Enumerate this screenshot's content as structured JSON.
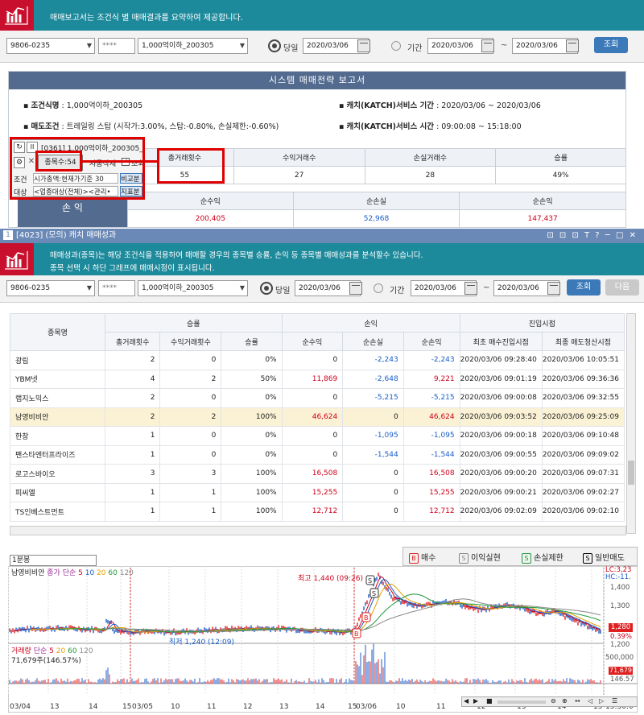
{
  "top_window": {
    "banner_text": "매매보고서는 조건식 별 매매결과를 요약하여 제공합니다.",
    "account": "9806-0235",
    "password": "****",
    "condition": "1,000억이하_200305",
    "today_label": "당일",
    "today_date": "2020/03/06",
    "period_label": "기간",
    "period_from": "2020/03/06",
    "period_to": "2020/03/06",
    "search_button": "조회",
    "report_title": "시스템 매매전략 보고서",
    "info": {
      "cond_name_label": "조건식명",
      "cond_name": ": 1,000억이하_200305",
      "sell_cond_label": "매도조건",
      "sell_cond": ": 트레일링 스탑 (시작가:3.00%, 스탑:-0.80%, 손실제한:-0.60%)",
      "catch_period_label": "캐치(KATCH)서비스 기간",
      "catch_period": ": 2020/03/06 ~ 2020/03/06",
      "catch_time_label": "캐치(KATCH)서비스 시간",
      "catch_time": ": 09:00:08 ~ 15:18:00"
    },
    "summary": {
      "headers": [
        "총거래횟수",
        "수익거래수",
        "손실거래수",
        "승률"
      ],
      "values": [
        "55",
        "27",
        "28",
        "49%"
      ],
      "pl_label": "손 익",
      "pl_headers": [
        "순수익",
        "순손실",
        "순손익"
      ],
      "pl_values": [
        "200,405",
        "52,968",
        "147,437"
      ]
    },
    "popup": {
      "title": "[0361] 1,000억이하_200305_",
      "count": "종목수:54",
      "auto_delete": "자동삭제",
      "check_label": "조회",
      "cond_label": "조건",
      "cond_value": "시가총액:현재가기준 30",
      "compare": "비교분",
      "target_label": "대상",
      "target_value": "<업종대상(전체)><관리•",
      "indicator": "지표분"
    }
  },
  "second_window": {
    "title": "[4023] (모의) 캐치 매매성과",
    "title_icons": "⊡ ⊡ ⊡ T ? ─ □ ✕",
    "banner_line1": "매매성과(종목)는 해당 조건식을 적용하여 매매할 경우의 종목별 승률, 손익 등 종목별 매매성과를 분석할수 있습니다.",
    "banner_line2": "종목 선택 시 하단 그래프에 매매시점이 표시됩니다.",
    "account": "9806-0235",
    "password": "****",
    "condition": "1,000억이하_200305",
    "today_label": "당일",
    "today_date": "2020/03/06",
    "period_label": "기간",
    "period_from": "2020/03/06",
    "period_to": "2020/03/06",
    "search_button": "조회",
    "next_button": "다음",
    "table": {
      "name_header": "종목명",
      "group_winrate": "승률",
      "group_pl": "손익",
      "group_entry": "진입시점",
      "sub_headers": [
        "총거래횟수",
        "수익거래횟수",
        "승률",
        "순수익",
        "순손실",
        "순손익",
        "최초 매수진입시점",
        "최종 매도청산시점"
      ],
      "rows": [
        [
          "광림",
          "2",
          "0",
          "0%",
          "0",
          "-2,243",
          "-2,243",
          "2020/03/06 09:28:40",
          "2020/03/06 10:05:51"
        ],
        [
          "YBM넷",
          "4",
          "2",
          "50%",
          "11,869",
          "-2,648",
          "9,221",
          "2020/03/06 09:01:19",
          "2020/03/06 09:36:36"
        ],
        [
          "랩지노믹스",
          "2",
          "0",
          "0%",
          "0",
          "-5,215",
          "-5,215",
          "2020/03/06 09:00:08",
          "2020/03/06 09:32:55"
        ],
        [
          "남영비비안",
          "2",
          "2",
          "100%",
          "46,624",
          "0",
          "46,624",
          "2020/03/06 09:03:52",
          "2020/03/06 09:25:09"
        ],
        [
          "한창",
          "1",
          "0",
          "0%",
          "0",
          "-1,095",
          "-1,095",
          "2020/03/06 09:00:18",
          "2020/03/06 09:10:48"
        ],
        [
          "팬스타엔터프라이즈",
          "1",
          "0",
          "0%",
          "0",
          "-1,544",
          "-1,544",
          "2020/03/06 09:00:55",
          "2020/03/06 09:09:02"
        ],
        [
          "로고스바이오",
          "3",
          "3",
          "100%",
          "16,508",
          "0",
          "16,508",
          "2020/03/06 09:00:20",
          "2020/03/06 09:07:31"
        ],
        [
          "피씨엘",
          "1",
          "1",
          "100%",
          "15,255",
          "0",
          "15,255",
          "2020/03/06 09:00:21",
          "2020/03/06 09:02:27"
        ],
        [
          "TS인베스트먼트",
          "1",
          "1",
          "100%",
          "12,712",
          "0",
          "12,712",
          "2020/03/06 09:02:09",
          "2020/03/06 09:02:10"
        ]
      ],
      "selected_row": 3
    },
    "chart": {
      "interval": "1분봉",
      "legend": [
        "매수",
        "이익실현",
        "손실제한",
        "일반매도"
      ],
      "legend_glyphs": [
        "B",
        "S",
        "S",
        "S"
      ],
      "price_label": "남영비비안",
      "price_ma_prefix": "종가 단순",
      "ma_periods": [
        "5",
        "10",
        "20",
        "60",
        "120"
      ],
      "high_note": "최고 1,440 (09:26)",
      "low_note": "최저 1,240 (12:09)",
      "lc": "LC:3,23",
      "hc": "HC:-11.",
      "price_ticks": [
        "1,400",
        "1,300",
        "1,200"
      ],
      "last_price": "1,280",
      "last_pct": "0.39%",
      "volume_label": "거래량",
      "volume_ma_prefix": "단순",
      "volume_ma_periods": [
        "5",
        "20",
        "60",
        "120"
      ],
      "volume_value": "71,679주(146.57%)",
      "volume_ticks": [
        "500,000",
        "146.57"
      ],
      "volume_last": "71,679",
      "time_labels": [
        "03/04",
        "13",
        "14",
        "15",
        "03/05",
        "10",
        "11",
        "12",
        "13",
        "14",
        "15",
        "03/06",
        "10",
        "11",
        "12",
        "13",
        "14",
        "15",
        "15:30:0"
      ],
      "colors": {
        "buy": "#e02020",
        "profit": "#333333",
        "loss": "#1f9a3a",
        "normal": "#000000",
        "candle_up": "#e02020",
        "candle_down": "#1a5dc8"
      }
    }
  }
}
